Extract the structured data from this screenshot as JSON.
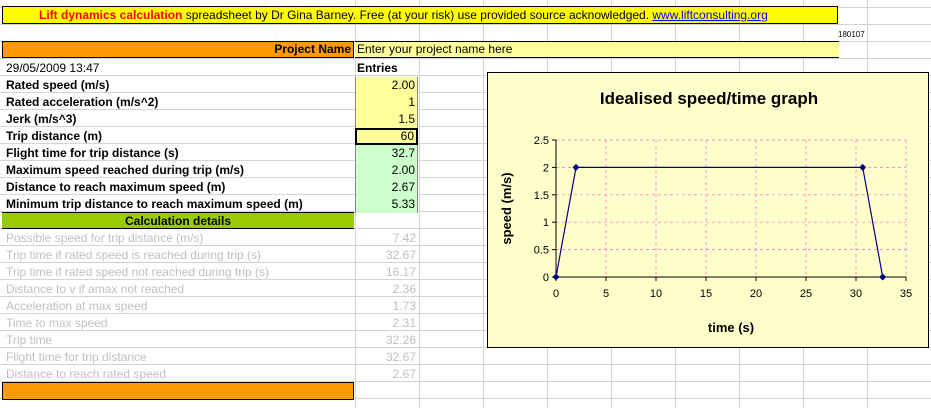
{
  "banner": {
    "title_red": "Lift dynamics calculation",
    "title_rest": " spreadsheet by Dr Gina Barney.  Free (at your risk) use provided source acknowledged.  ",
    "link": "www.liftconsulting.org",
    "code": "180107"
  },
  "project": {
    "label": "Project Name",
    "value": "Enter your project name here"
  },
  "timestamp": "29/05/2009 13:47",
  "entries_header": "Entries",
  "inputs": [
    {
      "label": "Rated speed (m/s)",
      "value": "2.00"
    },
    {
      "label": "Rated acceleration (m/s^2)",
      "value": "1"
    },
    {
      "label": "Jerk (m/s^3)",
      "value": "1.5"
    },
    {
      "label": "Trip distance (m)",
      "value": "60"
    }
  ],
  "outputs": [
    {
      "label": "Flight time for trip distance (s)",
      "value": "32.7"
    },
    {
      "label": "Maximum speed reached during trip (m/s)",
      "value": "2.00"
    },
    {
      "label": "Distance to reach maximum speed (m)",
      "value": "2.67"
    },
    {
      "label": "Minimum trip distance to reach maximum speed (m)",
      "value": "5.33"
    }
  ],
  "calc_header": "Calculation details",
  "details": [
    {
      "label": "Possible speed for trip distance (m/s)",
      "value": "7.42"
    },
    {
      "label": "Trip time if rated speed is reached during trip (s)",
      "value": "32.67"
    },
    {
      "label": "Trip time if rated speed not reached during trip (s)",
      "value": "16.17"
    },
    {
      "label": "Distance to v if amax not reached",
      "value": "2.36"
    },
    {
      "label": "Acceleration at max speed",
      "value": "1.73"
    },
    {
      "label": "Time to max speed",
      "value": "2.31"
    },
    {
      "label": "Trip time",
      "value": "32.26"
    },
    {
      "label": "Flight time for trip distance",
      "value": "32.67"
    },
    {
      "label": "Distance to reach rated speed",
      "value": "2.67"
    }
  ],
  "colors": {
    "banner": "#ffff00",
    "orange": "#ff9900",
    "input_fill": "#ffff99",
    "output_fill": "#ccffcc",
    "calc_header": "#99cc00",
    "chart_bg": "#ffffcc",
    "series": "#000080",
    "grid": "#ff66cc"
  },
  "chart_data": {
    "type": "line",
    "title": "Idealised speed/time graph",
    "xlabel": "time (s)",
    "ylabel": "speed (m/s)",
    "xlim": [
      0,
      35
    ],
    "ylim": [
      0,
      2.5
    ],
    "xticks": [
      "0",
      "5",
      "10",
      "15",
      "20",
      "25",
      "30",
      "35"
    ],
    "yticks": [
      "0",
      "0.5",
      "1",
      "1.5",
      "2",
      "2.5"
    ],
    "grid": true,
    "x": [
      0,
      2,
      30.67,
      32.67
    ],
    "y": [
      0,
      2,
      2,
      0
    ]
  }
}
